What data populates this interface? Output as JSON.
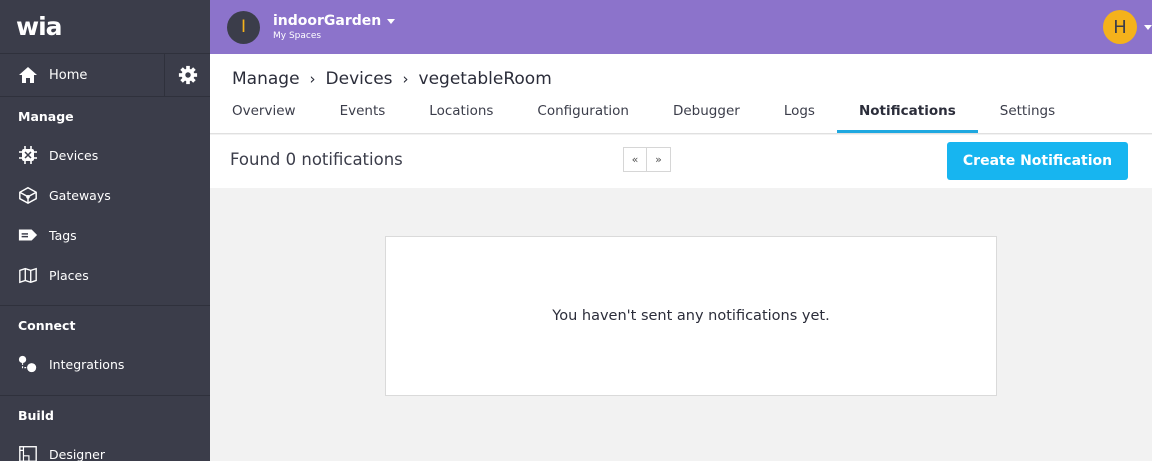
{
  "sidebar": {
    "logo": "wia",
    "home_label": "Home",
    "sections": {
      "manage": "Manage",
      "connect": "Connect",
      "build": "Build"
    },
    "items": {
      "devices": "Devices",
      "gateways": "Gateways",
      "tags": "Tags",
      "places": "Places",
      "integrations": "Integrations",
      "designer": "Designer"
    }
  },
  "topbar": {
    "space_initial": "I",
    "space_name": "indoorGarden",
    "space_sub": "My Spaces",
    "user_initial": "H"
  },
  "header": {
    "breadcrumb": [
      "Manage",
      "Devices",
      "vegetableRoom"
    ],
    "breadcrumb_sep": "›",
    "tabs": [
      "Overview",
      "Events",
      "Locations",
      "Configuration",
      "Debugger",
      "Logs",
      "Notifications",
      "Settings"
    ],
    "active_tab": "Notifications"
  },
  "toolbar": {
    "found_text": "Found 0 notifications",
    "prev_label": "«",
    "next_label": "»",
    "create_label": "Create Notification"
  },
  "main": {
    "empty_message": "You haven't sent any notifications yet."
  },
  "colors": {
    "sidebar_bg": "#3b3d4a",
    "topbar_bg": "#8c73cb",
    "accent": "#17b5f0",
    "avatar_yellow": "#f5b21b"
  }
}
